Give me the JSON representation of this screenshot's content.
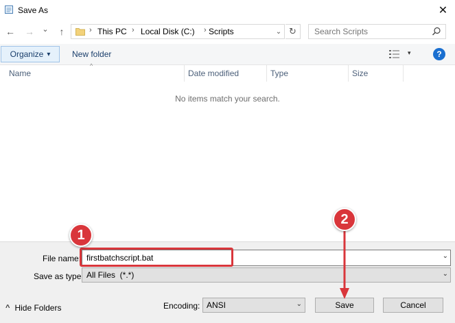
{
  "window": {
    "title": "Save As",
    "close_glyph": "✕",
    "title_icon": "notepad-icon"
  },
  "nav": {
    "back_glyph": "←",
    "forward_glyph": "→",
    "recent_glyph": "⌄",
    "up_glyph": "↑",
    "breadcrumbs": [
      "This PC",
      "Local Disk (C:)",
      "Scripts"
    ],
    "crumb_separator": "›",
    "dropdown_glyph": "⌄",
    "refresh_glyph": "↻"
  },
  "search": {
    "placeholder": "Search Scripts",
    "icon": "search-icon"
  },
  "toolbar": {
    "organize_label": "Organize",
    "organize_caret": "▾",
    "new_folder_label": "New folder",
    "view_caret": "▾",
    "help_label": "?"
  },
  "columns": {
    "sort_glyph": "^",
    "name": "Name",
    "date_modified": "Date modified",
    "type": "Type",
    "size": "Size"
  },
  "file_list": {
    "empty_message": "No items match your search."
  },
  "form": {
    "file_name_label": "File name:",
    "file_name_value": "firstbatchscript.bat",
    "save_as_type_label": "Save as type:",
    "save_as_type_value": "All Files  (*.*)",
    "dropdown_glyph": "⌄",
    "hide_folders_label": "Hide Folders",
    "hide_folders_glyph": "^",
    "encoding_label": "Encoding:",
    "encoding_value": "ANSI",
    "save_label": "Save",
    "cancel_label": "Cancel"
  },
  "annotations": {
    "step_1": "1",
    "step_2": "2",
    "accent_color": "#d9363b"
  }
}
